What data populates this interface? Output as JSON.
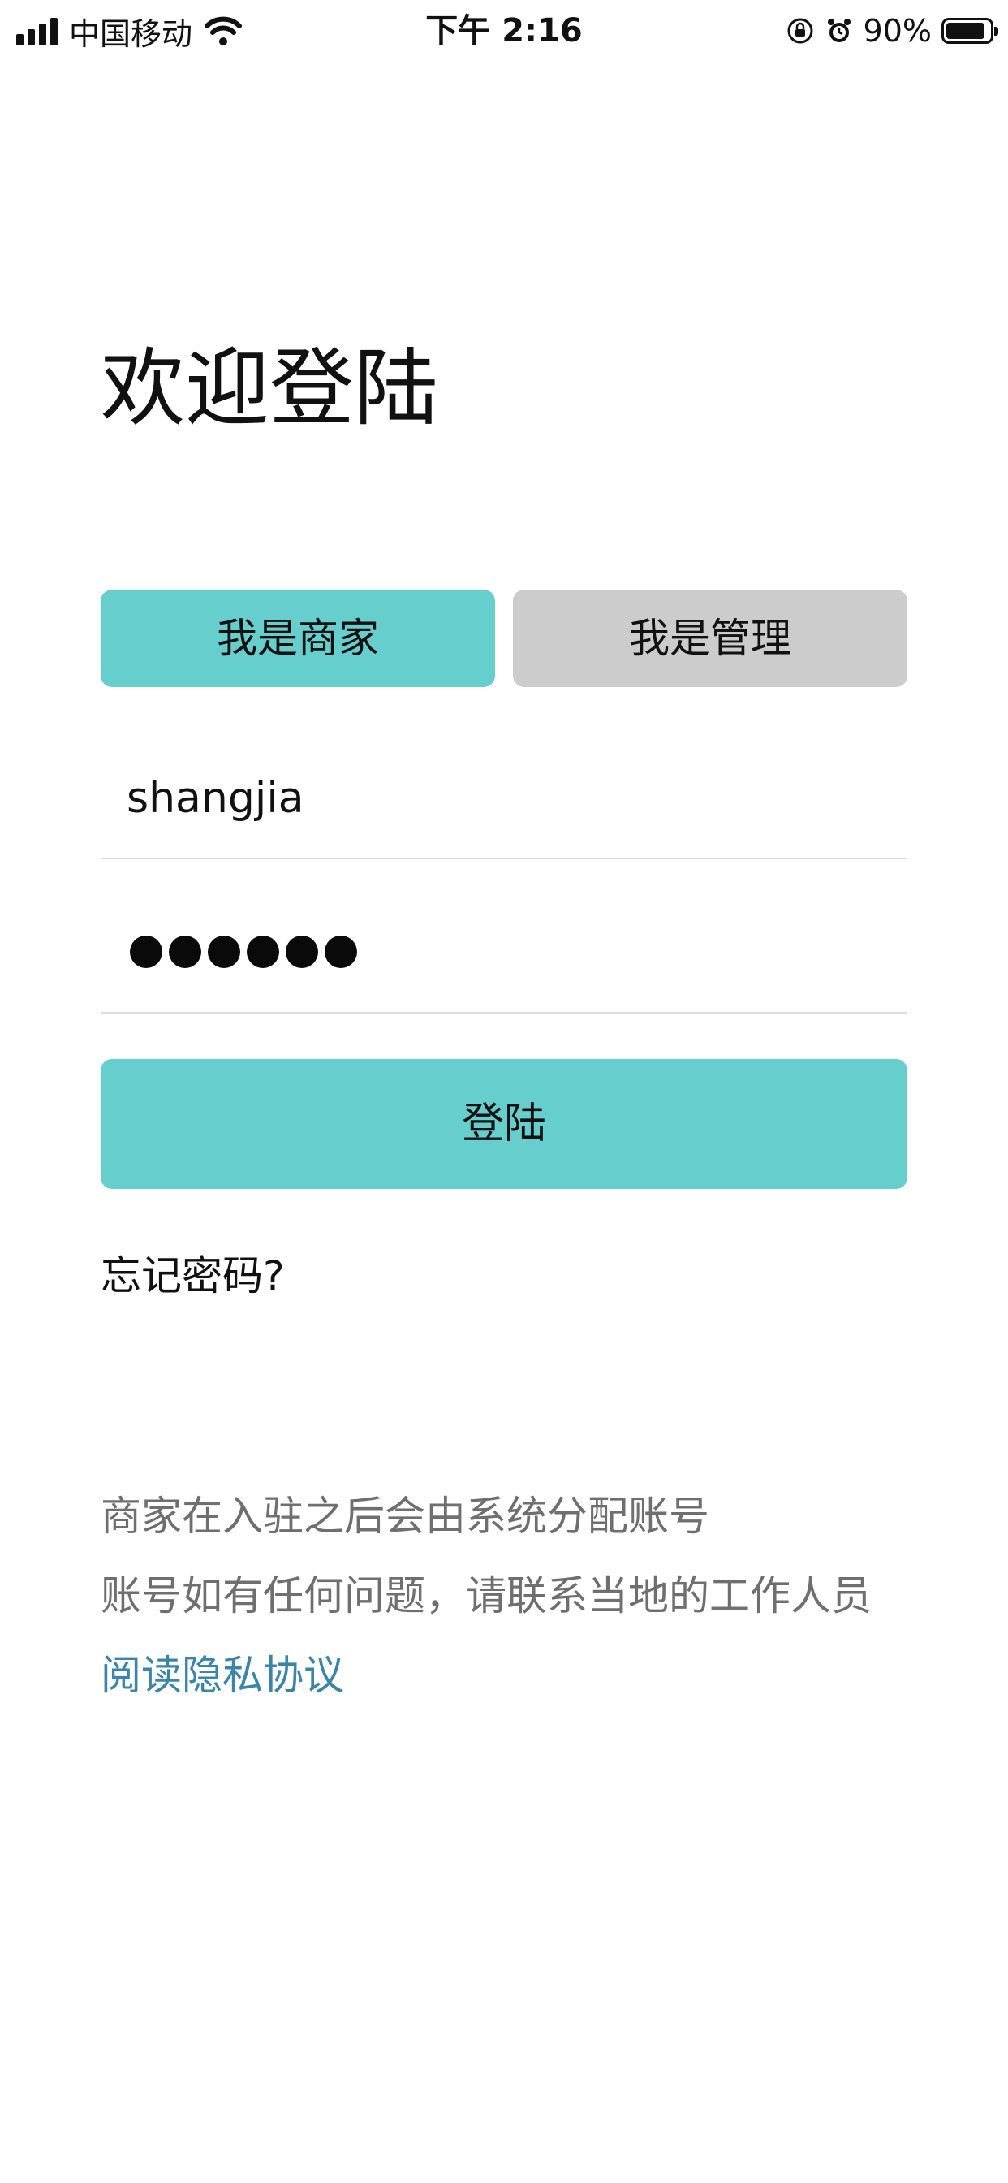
{
  "status_bar": {
    "carrier": "中国移动",
    "time": "下午 2:16",
    "battery_percent": "90%",
    "battery_level": 0.9,
    "icons": [
      "signal-icon",
      "wifi-icon",
      "orientation-lock-icon",
      "alarm-icon",
      "battery-icon"
    ]
  },
  "page": {
    "title": "欢迎登陆"
  },
  "role_tabs": {
    "merchant_label": "我是商家",
    "admin_label": "我是管理",
    "selected": "merchant"
  },
  "form": {
    "username_value": "shangjia",
    "password_value": "••••••",
    "password_length": 6,
    "login_label": "登陆",
    "forgot_label": "忘记密码?"
  },
  "notice": {
    "line1": "商家在入驻之后会由系统分配账号",
    "line2": "账号如有任何问题，请联系当地的工作人员",
    "privacy_link": "阅读隐私协议"
  },
  "colors": {
    "accent": "#66cfcd",
    "inactive_tab": "#cccccc",
    "link": "#3b86a8",
    "muted_text": "#6f6f6f",
    "divider": "#dddddd"
  }
}
